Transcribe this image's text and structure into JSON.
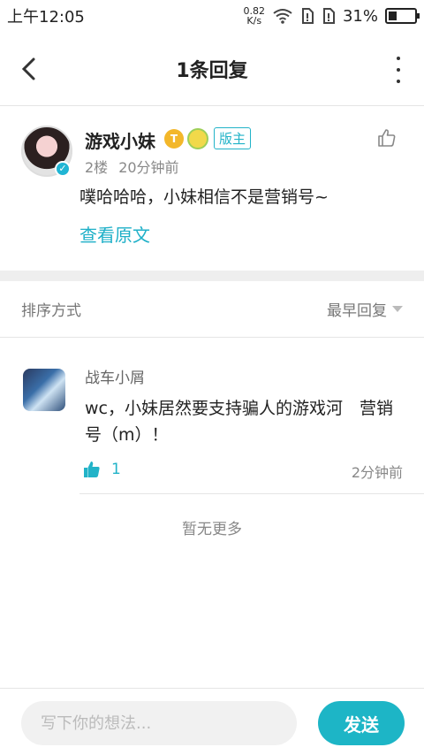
{
  "status_bar": {
    "time": "上午12:05",
    "net_speed_value": "0.82",
    "net_speed_unit": "K/s",
    "battery": "31%",
    "battery_level": 0.31
  },
  "header": {
    "title": "1条回复",
    "back_icon": "chevron-left-icon",
    "more_icon": "more-vertical-icon"
  },
  "post": {
    "username": "游戏小妹",
    "coin_badge": "T",
    "mod_badge": "版主",
    "floor": "2楼",
    "time": "20分钟前",
    "content": "噗哈哈哈，小妹相信不是营销号~",
    "view_original": "查看原文"
  },
  "sort": {
    "label": "排序方式",
    "selected": "最早回复"
  },
  "replies": [
    {
      "name": "战车小屑",
      "content": "wc，小妹居然要支持骗人的游戏河　营销号（m）！",
      "likes": "1",
      "time": "2分钟前"
    }
  ],
  "no_more": "暂无更多",
  "composer": {
    "placeholder": "写下你的想法...",
    "send_label": "发送"
  },
  "colors": {
    "accent": "#1db5c6"
  }
}
